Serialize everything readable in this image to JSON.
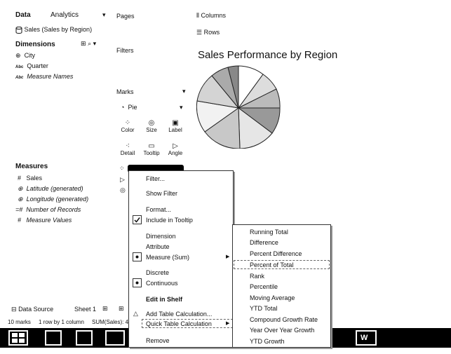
{
  "data_pane": {
    "tab_data": "Data",
    "tab_analytics": "Analytics",
    "datasource": "Sales (Sales by Region)",
    "dimensions_title": "Dimensions",
    "dimensions": [
      {
        "type": "Abc",
        "label": "City",
        "icon": "globe-icon"
      },
      {
        "type": "Abc",
        "label": "Quarter",
        "icon": "abc-icon"
      },
      {
        "type": "Abc",
        "label": "Measure Names",
        "icon": "abc-icon"
      }
    ],
    "measures_title": "Measures",
    "measures": [
      {
        "type": "#",
        "label": "Sales"
      },
      {
        "type": "globe",
        "label": "Latitude (generated)"
      },
      {
        "type": "globe",
        "label": "Longitude (generated)"
      },
      {
        "type": "=#",
        "label": "Number of Records"
      },
      {
        "type": "#",
        "label": "Measure Values"
      }
    ]
  },
  "shelves": {
    "pages": "Pages",
    "filters": "Filters",
    "marks": "Marks",
    "mark_type": "Pie",
    "mark_buttons": [
      "Color",
      "Size",
      "Label",
      "Detail",
      "Tooltip",
      "Angle"
    ],
    "columns": "Columns",
    "rows": "Rows"
  },
  "chart": {
    "title": "Sales Performance by Region"
  },
  "context_menu": {
    "items": [
      "Filter...",
      "Show Filter",
      "Format...",
      "Include in Tooltip",
      "Dimension",
      "Attribute",
      "Measure (Sum)",
      "Discrete",
      "Continuous",
      "Edit in Shelf",
      "Add Table Calculation...",
      "Quick Table Calculation",
      "Remove"
    ]
  },
  "submenu": {
    "items": [
      "Running Total",
      "Difference",
      "Percent Difference",
      "Percent of Total",
      "Rank",
      "Percentile",
      "Moving Average",
      "YTD Total",
      "Compound Growth Rate",
      "Year Over Year Growth",
      "YTD Growth"
    ],
    "highlighted": "Percent of Total"
  },
  "bottom_bar": {
    "data_source_tab": "Data Source",
    "sheet_tab": "Sheet 1",
    "status_marks": "10 marks",
    "status_rows": "1 row by 1 column",
    "status_sum": "SUM(Sales): 4"
  },
  "colors": {
    "taskbar": "#000000",
    "menu_border": "#333333",
    "highlight_border": "#666666"
  }
}
